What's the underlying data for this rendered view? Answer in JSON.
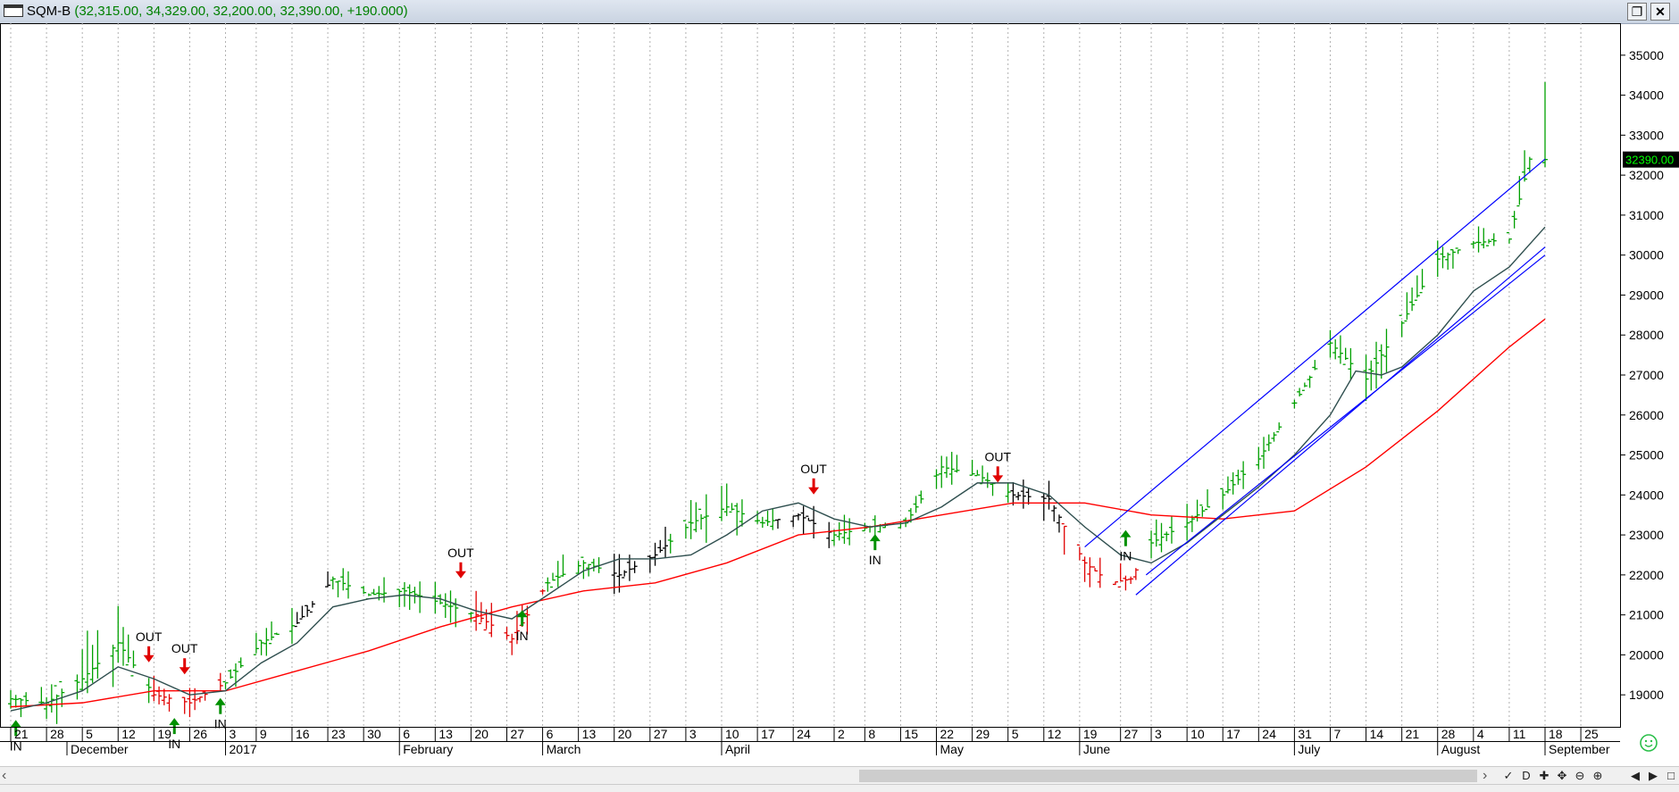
{
  "window": {
    "symbol": "SQM-B",
    "ohlc_text": "(32,315.00, 34,329.00, 32,200.00, 32,390.00, +190.000)",
    "restore_icon": "restore-icon",
    "close_icon": "close-icon"
  },
  "toolbar": {
    "icons": [
      "scroll-left-icon",
      "pin-icon",
      "d-icon",
      "cross-icon",
      "move-icon",
      "zoom-out-icon",
      "zoom-in-icon",
      "prev-icon",
      "next-icon",
      "end-icon"
    ],
    "smiley_icon": "smiley-icon"
  },
  "chart_data": {
    "type": "bar",
    "title": "",
    "ylim": [
      18200,
      35800
    ],
    "y_ticks": [
      "19000",
      "20000",
      "21000",
      "22000",
      "23000",
      "24000",
      "25000",
      "26000",
      "27000",
      "28000",
      "29000",
      "30000",
      "31000",
      "32000",
      "33000",
      "34000",
      "35000"
    ],
    "last_price_label": "32390.00",
    "x_days": [
      0,
      7,
      14,
      21,
      28,
      35,
      42,
      49,
      56,
      63,
      70,
      77,
      84,
      91,
      98,
      105,
      112,
      119,
      126,
      133,
      140,
      147,
      154,
      161,
      168,
      175,
      182,
      189,
      196,
      203,
      210,
      217,
      224,
      231,
      238,
      245,
      252,
      259,
      266,
      273,
      280,
      287,
      294,
      301,
      308,
      315,
      322,
      329,
      336,
      343,
      350,
      357,
      364,
      371,
      378,
      385,
      392,
      399
    ],
    "x_tick_labels": [
      "21",
      "28",
      "5",
      "12",
      "19",
      "26",
      "3",
      "9",
      "16",
      "23",
      "30",
      "6",
      "13",
      "20",
      "27",
      "6",
      "13",
      "20",
      "27",
      "3",
      "10",
      "17",
      "24",
      "2",
      "8",
      "15",
      "22",
      "29",
      "5",
      "12",
      "19",
      "27",
      "3",
      "10",
      "17",
      "24",
      "31",
      "7",
      "14",
      "21",
      "28",
      "4",
      "11",
      "18",
      "25"
    ],
    "x_tick_days": [
      0,
      7,
      14,
      21,
      28,
      35,
      42,
      48,
      55,
      62,
      69,
      76,
      83,
      90,
      97,
      104,
      111,
      118,
      125,
      132,
      139,
      146,
      153,
      161,
      167,
      174,
      181,
      188,
      195,
      202,
      209,
      217,
      223,
      230,
      237,
      244,
      251,
      258,
      265,
      272,
      279,
      286,
      293,
      300,
      307
    ],
    "month_labels": [
      "December",
      "2017",
      "February",
      "March",
      "April",
      "May",
      "June",
      "July",
      "August",
      "September"
    ],
    "month_days": [
      11,
      42,
      76,
      104,
      139,
      181,
      209,
      251,
      279,
      300
    ],
    "last_day": 300,
    "price_series": {
      "name": "",
      "days": [
        0,
        7,
        14,
        21,
        28,
        35,
        42,
        49,
        56,
        63,
        70,
        77,
        84,
        91,
        98,
        105,
        112,
        119,
        126,
        133,
        140,
        147,
        154,
        161,
        168,
        175,
        182,
        189,
        196,
        203,
        210,
        215,
        219,
        223,
        230,
        237,
        244,
        251,
        258,
        265,
        272,
        279,
        286,
        293,
        297,
        300
      ],
      "close": [
        18900,
        18800,
        19400,
        20300,
        19000,
        18800,
        19300,
        20300,
        20800,
        21900,
        21500,
        21600,
        21300,
        21000,
        20400,
        21800,
        22300,
        22000,
        22500,
        23300,
        23700,
        23300,
        23500,
        23000,
        23200,
        23300,
        24700,
        24500,
        24000,
        23900,
        22300,
        21800,
        21900,
        22800,
        23300,
        24000,
        24900,
        26300,
        27800,
        26900,
        28300,
        29900,
        30300,
        30400,
        32400,
        32390
      ],
      "high": [
        19300,
        19500,
        20900,
        20000,
        19500,
        19200,
        19800,
        20700,
        21600,
        22200,
        21900,
        21900,
        21600,
        21300,
        21100,
        22400,
        22700,
        22600,
        22800,
        24400,
        24400,
        23800,
        23800,
        23500,
        23800,
        23600,
        25100,
        24700,
        24300,
        24100,
        22800,
        22300,
        22400,
        23300,
        23700,
        24400,
        25400,
        26800,
        28100,
        27200,
        28800,
        30500,
        30700,
        30900,
        32600,
        34329
      ],
      "low": [
        18500,
        18400,
        18900,
        18100,
        18600,
        18500,
        19000,
        19900,
        20600,
        21200,
        21100,
        21100,
        20700,
        20200,
        20100,
        21400,
        21700,
        21600,
        22100,
        23000,
        23200,
        22900,
        23000,
        22700,
        22800,
        23000,
        24000,
        23900,
        23700,
        22700,
        21600,
        21600,
        21500,
        22300,
        22800,
        23600,
        24600,
        25900,
        27400,
        25800,
        27800,
        29500,
        29900,
        30000,
        31100,
        32200
      ],
      "phase": [
        "up",
        "up",
        "up",
        "up",
        "down",
        "down",
        "up",
        "up",
        "up",
        "up",
        "up",
        "up",
        "up",
        "down",
        "down",
        "up",
        "up",
        "up",
        "up",
        "up",
        "up",
        "up",
        "down",
        "up",
        "up",
        "up",
        "up",
        "up",
        "up",
        "down",
        "down",
        "down",
        "down",
        "up",
        "up",
        "up",
        "up",
        "up",
        "up",
        "up",
        "up",
        "up",
        "up",
        "up",
        "up",
        "up"
      ]
    },
    "ma_short_series": {
      "name": "",
      "days": [
        0,
        7,
        14,
        21,
        28,
        35,
        42,
        49,
        56,
        63,
        70,
        77,
        84,
        91,
        98,
        105,
        112,
        119,
        126,
        133,
        140,
        147,
        154,
        161,
        168,
        175,
        182,
        189,
        196,
        203,
        210,
        217,
        223,
        230,
        237,
        244,
        251,
        258,
        263,
        268,
        272,
        279,
        286,
        293,
        300
      ],
      "values": [
        18600,
        18800,
        19100,
        19700,
        19400,
        19000,
        19100,
        19800,
        20300,
        21200,
        21400,
        21500,
        21400,
        21100,
        20900,
        21500,
        22100,
        22400,
        22400,
        22500,
        23000,
        23600,
        23800,
        23400,
        23200,
        23300,
        23700,
        24300,
        24300,
        24000,
        23200,
        22500,
        22300,
        22800,
        23500,
        24200,
        25000,
        26000,
        27100,
        27000,
        27200,
        28000,
        29100,
        29700,
        30700
      ]
    },
    "ma_long_series": {
      "name": "",
      "days": [
        0,
        14,
        28,
        42,
        56,
        70,
        84,
        98,
        112,
        126,
        140,
        154,
        168,
        182,
        196,
        210,
        223,
        237,
        251,
        265,
        279,
        293,
        300
      ],
      "values": [
        18700,
        18800,
        19100,
        19100,
        19600,
        20100,
        20700,
        21200,
        21600,
        21800,
        22300,
        23000,
        23200,
        23500,
        23800,
        23800,
        23500,
        23400,
        23600,
        24700,
        26100,
        27700,
        28400
      ]
    },
    "trend_lines": [
      {
        "from": [
          210,
          22700
        ],
        "to": [
          300,
          32400
        ]
      },
      {
        "from": [
          220,
          21500
        ],
        "to": [
          300,
          30200
        ]
      },
      {
        "from": [
          222,
          22000
        ],
        "to": [
          300,
          30000
        ]
      }
    ],
    "signals": [
      {
        "type": "IN",
        "day": 1,
        "price": 18550
      },
      {
        "type": "OUT",
        "day": 27,
        "price": 19500
      },
      {
        "type": "OUT",
        "day": 34,
        "price": 19200
      },
      {
        "type": "IN",
        "day": 32,
        "price": 18600
      },
      {
        "type": "IN",
        "day": 41,
        "price": 19100
      },
      {
        "type": "OUT",
        "day": 88,
        "price": 21600
      },
      {
        "type": "IN",
        "day": 100,
        "price": 21300
      },
      {
        "type": "OUT",
        "day": 157,
        "price": 23700
      },
      {
        "type": "IN",
        "day": 169,
        "price": 23200
      },
      {
        "type": "OUT",
        "day": 193,
        "price": 24000
      },
      {
        "type": "IN",
        "day": 218,
        "price": 23300
      }
    ],
    "colors": {
      "up": "#00a000",
      "down": "#e00000",
      "flat": "#000000",
      "ma_short": "#2f4f4f",
      "ma_long": "#ff0000",
      "trend": "#0000ff",
      "grid": "#b0b0b0",
      "price_tag": "#00ff00"
    }
  }
}
